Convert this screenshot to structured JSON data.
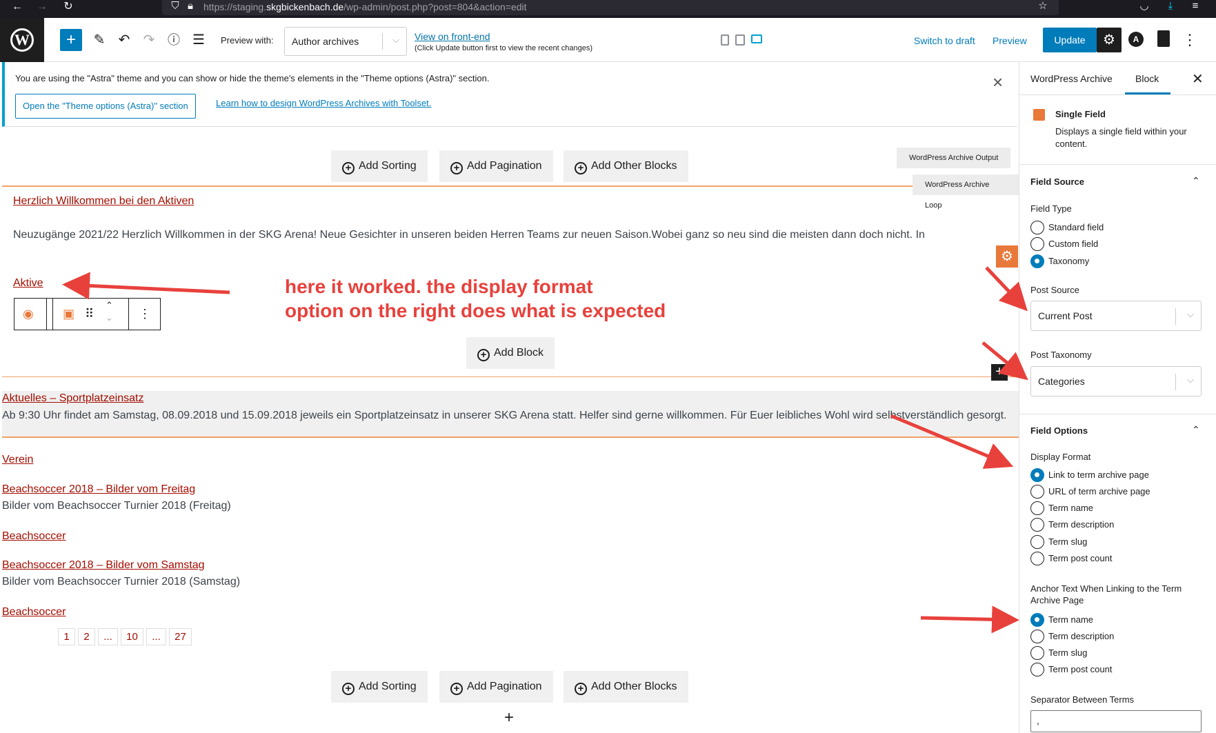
{
  "browser": {
    "url_prefix": "https://staging.",
    "url_domain": "skgbickenbach.de",
    "url_path": "/wp-admin/post.php?post=804&action=edit"
  },
  "toolbar": {
    "preview_with_label": "Preview with:",
    "preview_select_value": "Author archives",
    "view_front_end": "View on front-end",
    "view_front_end_note": "(Click Update button first to view the recent changes)",
    "switch_to_draft": "Switch to draft",
    "preview": "Preview",
    "update": "Update"
  },
  "notice": {
    "text": "You are using the \"Astra\" theme and you can show or hide the theme's elements in the \"Theme options (Astra)\" section.",
    "open_button": "Open the \"Theme options (Astra)\" section",
    "learn_link": "Learn how to design WordPress Archives with Toolset."
  },
  "editor": {
    "add_sorting": "Add Sorting",
    "add_pagination": "Add Pagination",
    "add_other_blocks": "Add Other Blocks",
    "tag_output": "WordPress Archive Output",
    "tag_loop": "WordPress Archive Loop",
    "add_block": "Add Block",
    "posts": [
      {
        "title": "Herzlich Willkommen bei den Aktiven",
        "text": "Neuzugänge 2021/22 Herzlich Willkommen in der SKG Arena! Neue Gesichter in unseren beiden Herren Teams zur neuen Saison.Wobei ganz so neu sind die meisten dann doch nicht. In",
        "term": "Aktive"
      },
      {
        "title": "Aktuelles – Sportplatzeinsatz",
        "text": "Ab 9:30 Uhr findet am Samstag, 08.09.2018 und 15.09.2018 jeweils ein Sportplatzeinsatz in unserer SKG Arena statt. Helfer sind gerne willkommen. Für Euer leibliches Wohl wird selbstverständlich gesorgt.",
        "term": "Verein"
      },
      {
        "title": "Beachsoccer 2018 – Bilder vom Freitag",
        "text": "Bilder vom Beachsoccer Turnier 2018 (Freitag)",
        "term": "Beachsoccer"
      },
      {
        "title": "Beachsoccer 2018 – Bilder vom Samstag",
        "text": "Bilder vom Beachsoccer Turnier 2018 (Samstag)",
        "term": "Beachsoccer"
      }
    ],
    "pagination": [
      "1",
      "2",
      "...",
      "10",
      "...",
      "27"
    ],
    "annotation_line1": "here it worked. the display format",
    "annotation_line2": "option on the right does what is expected"
  },
  "sidebar": {
    "tab_archive": "WordPress Archive",
    "tab_block": "Block",
    "block_name": "Single Field",
    "block_desc": "Displays a single field within your content.",
    "field_source_title": "Field Source",
    "field_type_label": "Field Type",
    "field_types": [
      "Standard field",
      "Custom field",
      "Taxonomy"
    ],
    "post_source_label": "Post Source",
    "post_source_value": "Current Post",
    "post_taxonomy_label": "Post Taxonomy",
    "post_taxonomy_value": "Categories",
    "field_options_title": "Field Options",
    "display_format_label": "Display Format",
    "display_formats": [
      "Link to term archive page",
      "URL of term archive page",
      "Term name",
      "Term description",
      "Term slug",
      "Term post count"
    ],
    "anchor_label": "Anchor Text When Linking to the Term Archive Page",
    "anchor_options": [
      "Term name",
      "Term description",
      "Term slug",
      "Term post count"
    ],
    "separator_label": "Separator Between Terms",
    "separator_value": ","
  },
  "colors": {
    "accent": "#007cba",
    "link_red": "#a30d00",
    "annotation": "#e8413c",
    "toolset_orange": "#e8793a"
  }
}
